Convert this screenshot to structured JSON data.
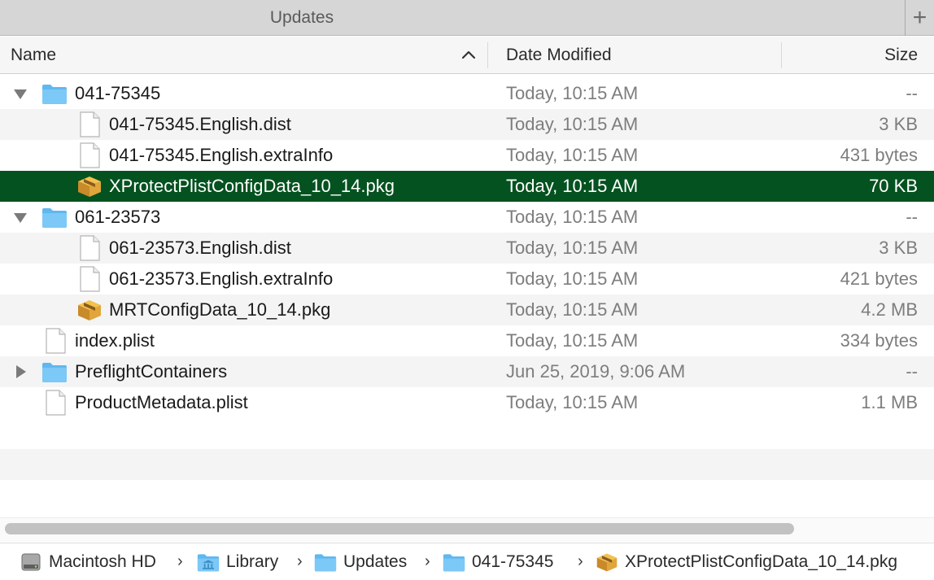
{
  "tab": {
    "title": "Updates",
    "new_tab_symbol": "+"
  },
  "columns": {
    "name": "Name",
    "date": "Date Modified",
    "size": "Size"
  },
  "rows": [
    {
      "name": "041-75345",
      "date": "Today, 10:15 AM",
      "size": "--",
      "kind": "folder",
      "depth": 0,
      "disclosure": "expanded"
    },
    {
      "name": "041-75345.English.dist",
      "date": "Today, 10:15 AM",
      "size": "3 KB",
      "kind": "file",
      "depth": 1
    },
    {
      "name": "041-75345.English.extraInfo",
      "date": "Today, 10:15 AM",
      "size": "431 bytes",
      "kind": "file",
      "depth": 1
    },
    {
      "name": "XProtectPlistConfigData_10_14.pkg",
      "date": "Today, 10:15 AM",
      "size": "70 KB",
      "kind": "package",
      "depth": 1,
      "selected": true
    },
    {
      "name": "061-23573",
      "date": "Today, 10:15 AM",
      "size": "--",
      "kind": "folder",
      "depth": 0,
      "disclosure": "expanded"
    },
    {
      "name": "061-23573.English.dist",
      "date": "Today, 10:15 AM",
      "size": "3 KB",
      "kind": "file",
      "depth": 1
    },
    {
      "name": "061-23573.English.extraInfo",
      "date": "Today, 10:15 AM",
      "size": "421 bytes",
      "kind": "file",
      "depth": 1
    },
    {
      "name": "MRTConfigData_10_14.pkg",
      "date": "Today, 10:15 AM",
      "size": "4.2 MB",
      "kind": "package",
      "depth": 1
    },
    {
      "name": "index.plist",
      "date": "Today, 10:15 AM",
      "size": "334 bytes",
      "kind": "file",
      "depth": 0
    },
    {
      "name": "PreflightContainers",
      "date": "Jun 25, 2019, 9:06 AM",
      "size": "--",
      "kind": "folder",
      "depth": 0,
      "disclosure": "collapsed"
    },
    {
      "name": "ProductMetadata.plist",
      "date": "Today, 10:15 AM",
      "size": "1.1 MB",
      "kind": "file",
      "depth": 0
    }
  ],
  "path_bar": [
    {
      "label": "Macintosh HD",
      "icon": "hard-drive-icon"
    },
    {
      "label": "Library",
      "icon": "library-folder-icon"
    },
    {
      "label": "Updates",
      "icon": "folder-icon"
    },
    {
      "label": "041-75345",
      "icon": "folder-icon"
    },
    {
      "label": "XProtectPlistConfigData_10_14.pkg",
      "icon": "package-icon"
    }
  ],
  "colors": {
    "selection": "#04521f",
    "folder": "#5fb8f0",
    "secondary_text": "#7d7d7d"
  }
}
